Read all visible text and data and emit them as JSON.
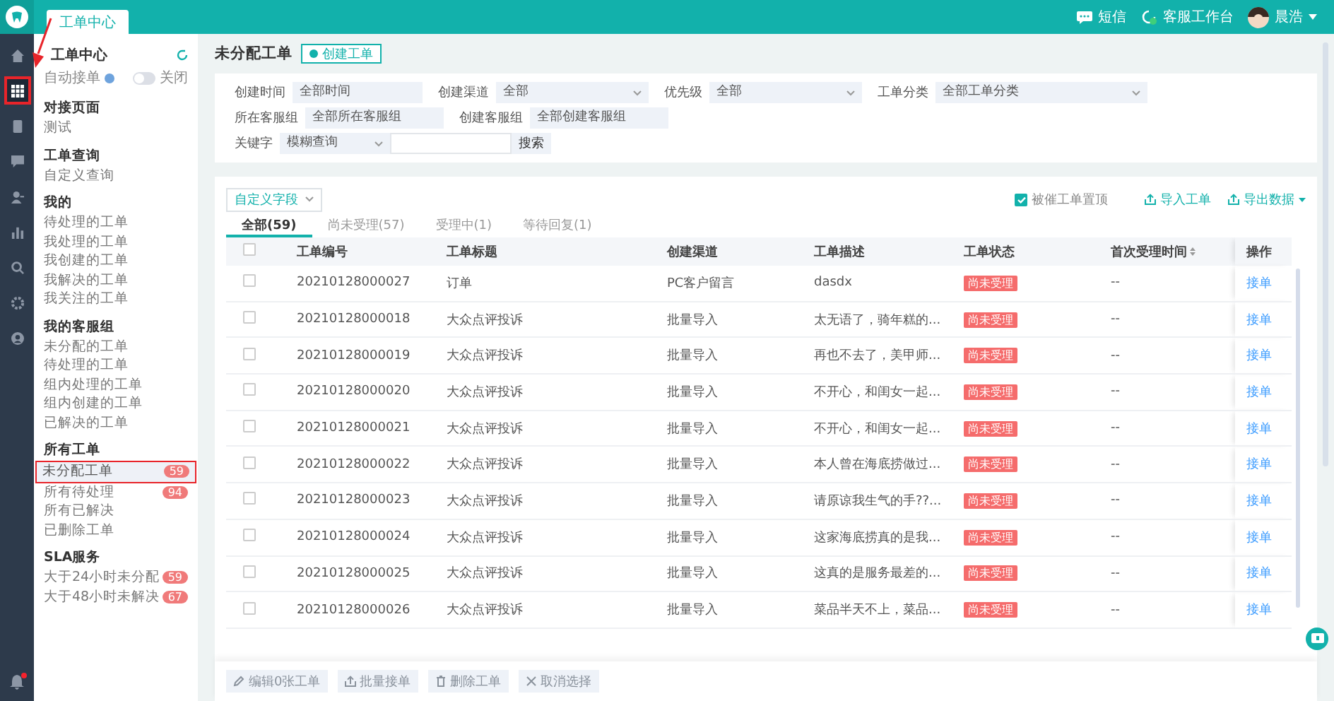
{
  "top_bar": {
    "tabs": [
      {
        "label": "工单中心",
        "selected": true
      }
    ],
    "actions": [
      {
        "label": "短信"
      },
      {
        "label": "客服工作台"
      }
    ],
    "user": {
      "name": "晨浩"
    }
  },
  "rail": {
    "items": [
      {
        "selected": false,
        "highlighted": false
      },
      {
        "selected": true,
        "highlighted": true
      },
      {
        "selected": false,
        "highlighted": false
      },
      {
        "selected": false,
        "highlighted": false
      },
      {
        "selected": false,
        "highlighted": false
      },
      {
        "selected": false,
        "highlighted": false
      },
      {
        "selected": false,
        "highlighted": false
      },
      {
        "selected": false,
        "highlighted": false
      },
      {
        "selected": false,
        "highlighted": false
      }
    ],
    "notification_dot": true
  },
  "sidebar": {
    "title": "工单中心",
    "auto_accept": {
      "label": "自动接单",
      "on": false,
      "state_label": "关闭"
    },
    "sections": [
      {
        "heading": "对接页面",
        "items": [
          {
            "label": "测试",
            "selected": false,
            "highlighted": false
          }
        ]
      },
      {
        "heading": "工单查询",
        "items": [
          {
            "label": "自定义查询",
            "selected": false,
            "highlighted": false
          }
        ]
      },
      {
        "heading": "我的",
        "items": [
          {
            "label": "待处理的工单",
            "selected": false,
            "highlighted": false
          },
          {
            "label": "我处理的工单",
            "selected": false,
            "highlighted": false
          },
          {
            "label": "我创建的工单",
            "selected": false,
            "highlighted": false
          },
          {
            "label": "我解决的工单",
            "selected": false,
            "highlighted": false
          },
          {
            "label": "我关注的工单",
            "selected": false,
            "highlighted": false
          }
        ]
      },
      {
        "heading": "我的客服组",
        "items": [
          {
            "label": "未分配的工单",
            "selected": false,
            "highlighted": false
          },
          {
            "label": "待处理的工单",
            "selected": false,
            "highlighted": false
          },
          {
            "label": "组内处理的工单",
            "selected": false,
            "highlighted": false
          },
          {
            "label": "组内创建的工单",
            "selected": false,
            "highlighted": false
          },
          {
            "label": "已解决的工单",
            "selected": false,
            "highlighted": false
          }
        ]
      },
      {
        "heading": "所有工单",
        "items": [
          {
            "label": "未分配工单",
            "badge": "59",
            "selected": true,
            "highlighted": true
          },
          {
            "label": "所有待处理",
            "badge": "94",
            "selected": false,
            "highlighted": false
          },
          {
            "label": "所有已解决",
            "selected": false,
            "highlighted": false
          },
          {
            "label": "已删除工单",
            "selected": false,
            "highlighted": false
          }
        ]
      },
      {
        "heading": "SLA服务",
        "items": [
          {
            "label": "大于24小时未分配",
            "badge": "59",
            "selected": false,
            "highlighted": false
          },
          {
            "label": "大于48小时未解决",
            "badge": "67",
            "selected": false,
            "highlighted": false
          }
        ]
      }
    ]
  },
  "page": {
    "title": "未分配工单",
    "create_button": "创建工单"
  },
  "filters": {
    "rows": [
      [
        {
          "kind": "text",
          "label": "创建时间",
          "value": "全部时间"
        },
        {
          "kind": "select",
          "label": "创建渠道",
          "value": "全部"
        },
        {
          "kind": "select",
          "label": "优先级",
          "value": "全部"
        },
        {
          "kind": "select",
          "label": "工单分类",
          "value": "全部工单分类"
        }
      ],
      [
        {
          "kind": "text",
          "label": "所在客服组",
          "value": "全部所在客服组"
        },
        {
          "kind": "text",
          "label": "创建客服组",
          "value": "全部创建客服组"
        }
      ],
      [
        {
          "kind": "search",
          "label": "关键字",
          "value": "模糊查询",
          "button": "搜索"
        }
      ]
    ]
  },
  "table_panel": {
    "field_select": "自定义字段",
    "pin_urged": {
      "label": "被催工单置顶",
      "checked": true
    },
    "import": "导入工单",
    "export": "导出数据",
    "tabs": [
      {
        "label": "全部(59)",
        "selected": true
      },
      {
        "label": "尚未受理(57)",
        "selected": false
      },
      {
        "label": "受理中(1)",
        "selected": false
      },
      {
        "label": "等待回复(1)",
        "selected": false
      }
    ],
    "select_all": {
      "checked": false
    },
    "columns": [
      "工单编号",
      "工单标题",
      "创建渠道",
      "工单描述",
      "工单状态",
      "首次受理时间",
      "操作"
    ],
    "rows": [
      {
        "checked": false,
        "id": "20210128000027",
        "title": "订单",
        "channel": "PC客户留言",
        "description": "dasdx",
        "status": "尚未受理",
        "first_time": "--",
        "action": "接单"
      },
      {
        "checked": false,
        "id": "20210128000018",
        "title": "大众点评投诉",
        "channel": "批量导入",
        "description": "太无语了，骑年糕的...",
        "status": "尚未受理",
        "first_time": "--",
        "action": "接单"
      },
      {
        "checked": false,
        "id": "20210128000019",
        "title": "大众点评投诉",
        "channel": "批量导入",
        "description": "再也不去了，美甲师...",
        "status": "尚未受理",
        "first_time": "--",
        "action": "接单"
      },
      {
        "checked": false,
        "id": "20210128000020",
        "title": "大众点评投诉",
        "channel": "批量导入",
        "description": "不开心，和闺女一起...",
        "status": "尚未受理",
        "first_time": "--",
        "action": "接单"
      },
      {
        "checked": false,
        "id": "20210128000021",
        "title": "大众点评投诉",
        "channel": "批量导入",
        "description": "不开心，和闺女一起...",
        "status": "尚未受理",
        "first_time": "--",
        "action": "接单"
      },
      {
        "checked": false,
        "id": "20210128000022",
        "title": "大众点评投诉",
        "channel": "批量导入",
        "description": "本人曾在海底捞做过...",
        "status": "尚未受理",
        "first_time": "--",
        "action": "接单"
      },
      {
        "checked": false,
        "id": "20210128000023",
        "title": "大众点评投诉",
        "channel": "批量导入",
        "description": "请原谅我生气的手??...",
        "status": "尚未受理",
        "first_time": "--",
        "action": "接单"
      },
      {
        "checked": false,
        "id": "20210128000024",
        "title": "大众点评投诉",
        "channel": "批量导入",
        "description": "这家海底捞真的是我...",
        "status": "尚未受理",
        "first_time": "--",
        "action": "接单"
      },
      {
        "checked": false,
        "id": "20210128000025",
        "title": "大众点评投诉",
        "channel": "批量导入",
        "description": "这真的是服务最差的...",
        "status": "尚未受理",
        "first_time": "--",
        "action": "接单"
      },
      {
        "checked": false,
        "id": "20210128000026",
        "title": "大众点评投诉",
        "channel": "批量导入",
        "description": "菜品半天不上，菜品...",
        "status": "尚未受理",
        "first_time": "--",
        "action": "接单"
      }
    ],
    "bulk_actions": [
      {
        "kind": "edit",
        "label": "编辑0张工单",
        "disabled": true
      },
      {
        "kind": "accept",
        "label": "批量接单",
        "disabled": true
      },
      {
        "kind": "delete",
        "label": "删除工单",
        "disabled": true
      },
      {
        "kind": "cancel",
        "label": "取消选择",
        "disabled": true
      }
    ]
  }
}
